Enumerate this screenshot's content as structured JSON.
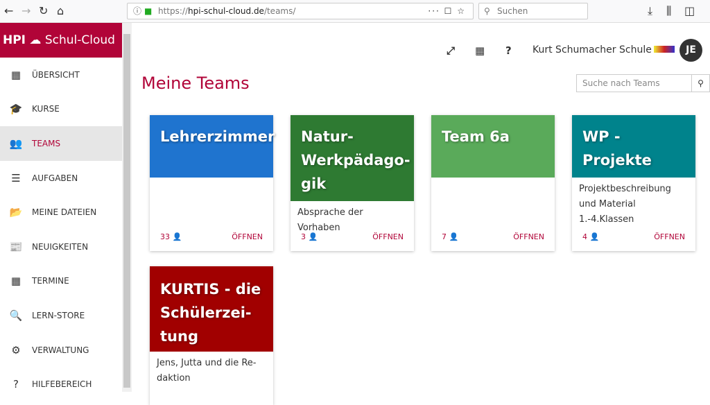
{
  "browser": {
    "url_prefix": "https://",
    "url_host": "hpi-schul-cloud.de",
    "url_path": "/teams/",
    "search_placeholder": "Suchen"
  },
  "logo": {
    "hpi": "HPI",
    "name": "Schul-Cloud"
  },
  "sidebar": {
    "items": [
      {
        "label": "ÜBERSICHT",
        "icon": "▦"
      },
      {
        "label": "KURSE",
        "icon": "🎓"
      },
      {
        "label": "TEAMS",
        "icon": "👥"
      },
      {
        "label": "AUFGABEN",
        "icon": "☰"
      },
      {
        "label": "MEINE DATEIEN",
        "icon": "📂"
      },
      {
        "label": "NEUIGKEITEN",
        "icon": "📰"
      },
      {
        "label": "TERMINE",
        "icon": "▦"
      },
      {
        "label": "LERN-STORE",
        "icon": "🔍"
      },
      {
        "label": "VERWALTUNG",
        "icon": "⚙"
      },
      {
        "label": "HILFEBEREICH",
        "icon": "?"
      }
    ]
  },
  "header": {
    "school": "Kurt Schumacher Schule",
    "avatar": "JE",
    "help": "?"
  },
  "page": {
    "title": "Meine Teams",
    "search_placeholder": "Suche nach Teams"
  },
  "teams": [
    {
      "name": "Lehrerzimmer",
      "description": "",
      "members": "33",
      "open": "ÖFFNEN",
      "color": "#1f74cf"
    },
    {
      "name": "Natur-Werkpädago-gik",
      "description": "Absprache der Vorhaben",
      "members": "3",
      "open": "ÖFFNEN",
      "color": "#2e7a32"
    },
    {
      "name": "Team 6a",
      "description": "",
      "members": "7",
      "open": "ÖFFNEN",
      "color": "#5aaa5a"
    },
    {
      "name": "WP - Projekte",
      "description": "Projektbeschreibung und Material 1.-4.Klassen",
      "members": "4",
      "open": "ÖFFNEN",
      "color": "#00838c"
    },
    {
      "name": "KURTIS - die Schülerzei-tung",
      "description": "Jens, Jutta und die Re-daktion",
      "members": "",
      "open": "",
      "color": "#a10000"
    }
  ]
}
